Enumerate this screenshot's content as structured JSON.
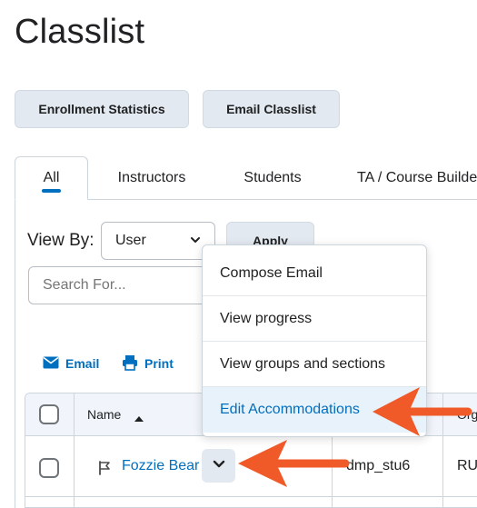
{
  "page": {
    "title": "Classlist"
  },
  "toolbar": {
    "enrollment_stats": "Enrollment Statistics",
    "email_classlist": "Email Classlist"
  },
  "tabs": [
    {
      "label": "All",
      "active": true
    },
    {
      "label": "Instructors"
    },
    {
      "label": "Students"
    },
    {
      "label": "TA / Course Builde"
    }
  ],
  "filters": {
    "view_by_label": "View By:",
    "view_by_value": "User",
    "apply_label": "Apply",
    "search_placeholder": "Search For..."
  },
  "actions": {
    "email_label": "Email",
    "print_label": "Print"
  },
  "table": {
    "columns": {
      "name": "Name",
      "org": "Org"
    },
    "rows": [
      {
        "name": "Fozzie Bear",
        "username": "dmp_stu6",
        "role": "RU"
      }
    ]
  },
  "context_menu": {
    "items": [
      {
        "label": "Compose Email"
      },
      {
        "label": "View progress"
      },
      {
        "label": "View groups and sections"
      },
      {
        "label": "Edit Accommodations",
        "highlighted": true
      }
    ]
  },
  "colors": {
    "accent": "#006fbf",
    "arrow": "#f05a28",
    "button_bg": "#e3e9f1"
  }
}
